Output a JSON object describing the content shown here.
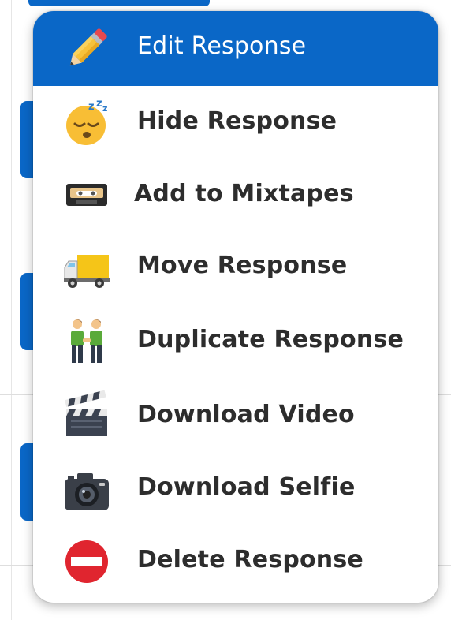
{
  "menu": {
    "items": [
      {
        "label": "Edit Response",
        "icon": "pencil-icon",
        "active": true
      },
      {
        "label": "Hide Response",
        "icon": "sleeping-face-icon",
        "active": false
      },
      {
        "label": "Add to Mixtapes",
        "icon": "cassette-tape-icon",
        "active": false
      },
      {
        "label": "Move Response",
        "icon": "delivery-truck-icon",
        "active": false
      },
      {
        "label": "Duplicate Response",
        "icon": "two-men-holding-hands-icon",
        "active": false
      },
      {
        "label": "Download Video",
        "icon": "clapper-board-icon",
        "active": false
      },
      {
        "label": "Download Selfie",
        "icon": "camera-icon",
        "active": false
      },
      {
        "label": "Delete Response",
        "icon": "no-entry-icon",
        "active": false
      }
    ]
  },
  "colors": {
    "accent": "#0a67c7",
    "text": "#2d2d2d",
    "active_text": "#ffffff"
  }
}
